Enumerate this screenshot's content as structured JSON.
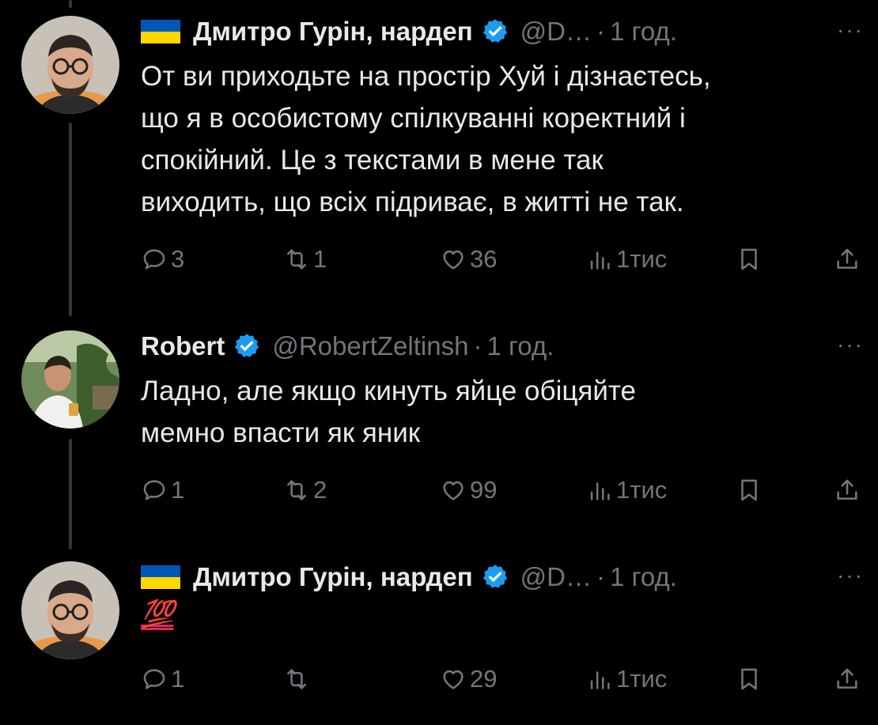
{
  "thread": [
    {
      "author": {
        "flag_icon": "ukraine-flag-icon",
        "name": "Дмитро Гурін, нардеп",
        "verified": true,
        "handle": "@D…",
        "time": "1 год."
      },
      "text": "От ви приходьте на простір Хуй і дізнаєтесь,\nщо я в особистому спілкуванні коректний і\nспокійний. Це з текстами в мене так\nвиходить, що всіх підриває, в житті не так.",
      "stats": {
        "replies": "3",
        "reposts": "1",
        "likes": "36",
        "views": "1тис"
      }
    },
    {
      "author": {
        "name": "Robert",
        "verified": true,
        "handle": "@RobertZeltinsh",
        "time": "1 год."
      },
      "text": "Ладно, але якщо кинуть яйце обіцяйте\nмемно впасти як яник",
      "stats": {
        "replies": "1",
        "reposts": "2",
        "likes": "99",
        "views": "1тис"
      }
    },
    {
      "author": {
        "flag_icon": "ukraine-flag-icon",
        "name": "Дмитро Гурін, нардеп",
        "verified": true,
        "handle": "@D…",
        "time": "1 год."
      },
      "text": "💯",
      "stats": {
        "replies": "1",
        "reposts": "",
        "likes": "29",
        "views": "1тис"
      }
    }
  ],
  "ui": {
    "separator": "·",
    "more": "···"
  },
  "colors": {
    "background": "#000000",
    "text": "#e7e9ea",
    "muted": "#71767b",
    "verified": "#1d9bf0",
    "thread_line": "#333639",
    "flag_blue": "#0057b7",
    "flag_yellow": "#ffd700"
  }
}
